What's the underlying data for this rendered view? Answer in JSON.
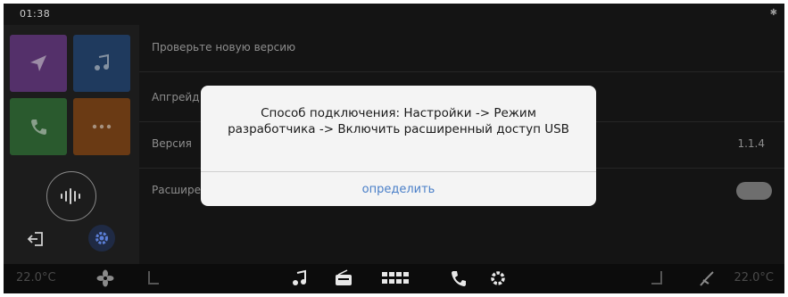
{
  "status": {
    "time": "01:38",
    "bluetooth_icon": "bluetooth-icon"
  },
  "sidebar": {
    "tiles": [
      {
        "icon": "navigation-icon",
        "color": "#54306a"
      },
      {
        "icon": "music-icon",
        "color": "#1f3a5e"
      },
      {
        "icon": "phone-icon",
        "color": "#2a5a2e"
      },
      {
        "icon": "more-icon",
        "color": "#6a3a14"
      }
    ],
    "voice_icon": "voice-assistant-icon",
    "exit_icon": "exit-icon",
    "settings_icon": "gear-icon"
  },
  "settings": {
    "check_update_label": "Проверьте новую версию",
    "upgrade_label": "Апгрейд",
    "version_label": "Версия",
    "version_value": "1.1.4",
    "extended_label": "Расширенный доступ USB",
    "extended_toggle_on": false
  },
  "dialog": {
    "message": "Способ подключения: Настройки -> Режим разработчика -> Включить расширенный доступ USB",
    "button_label": "определить"
  },
  "dock": {
    "temp_left": "22.0°C",
    "temp_right": "22.0°C",
    "icons": [
      "fan-icon",
      "seat-left-icon",
      "music-icon",
      "radio-icon",
      "apps-icon",
      "phone-icon",
      "settings-icon",
      "seat-right-icon",
      "seat-heat-icon"
    ]
  }
}
